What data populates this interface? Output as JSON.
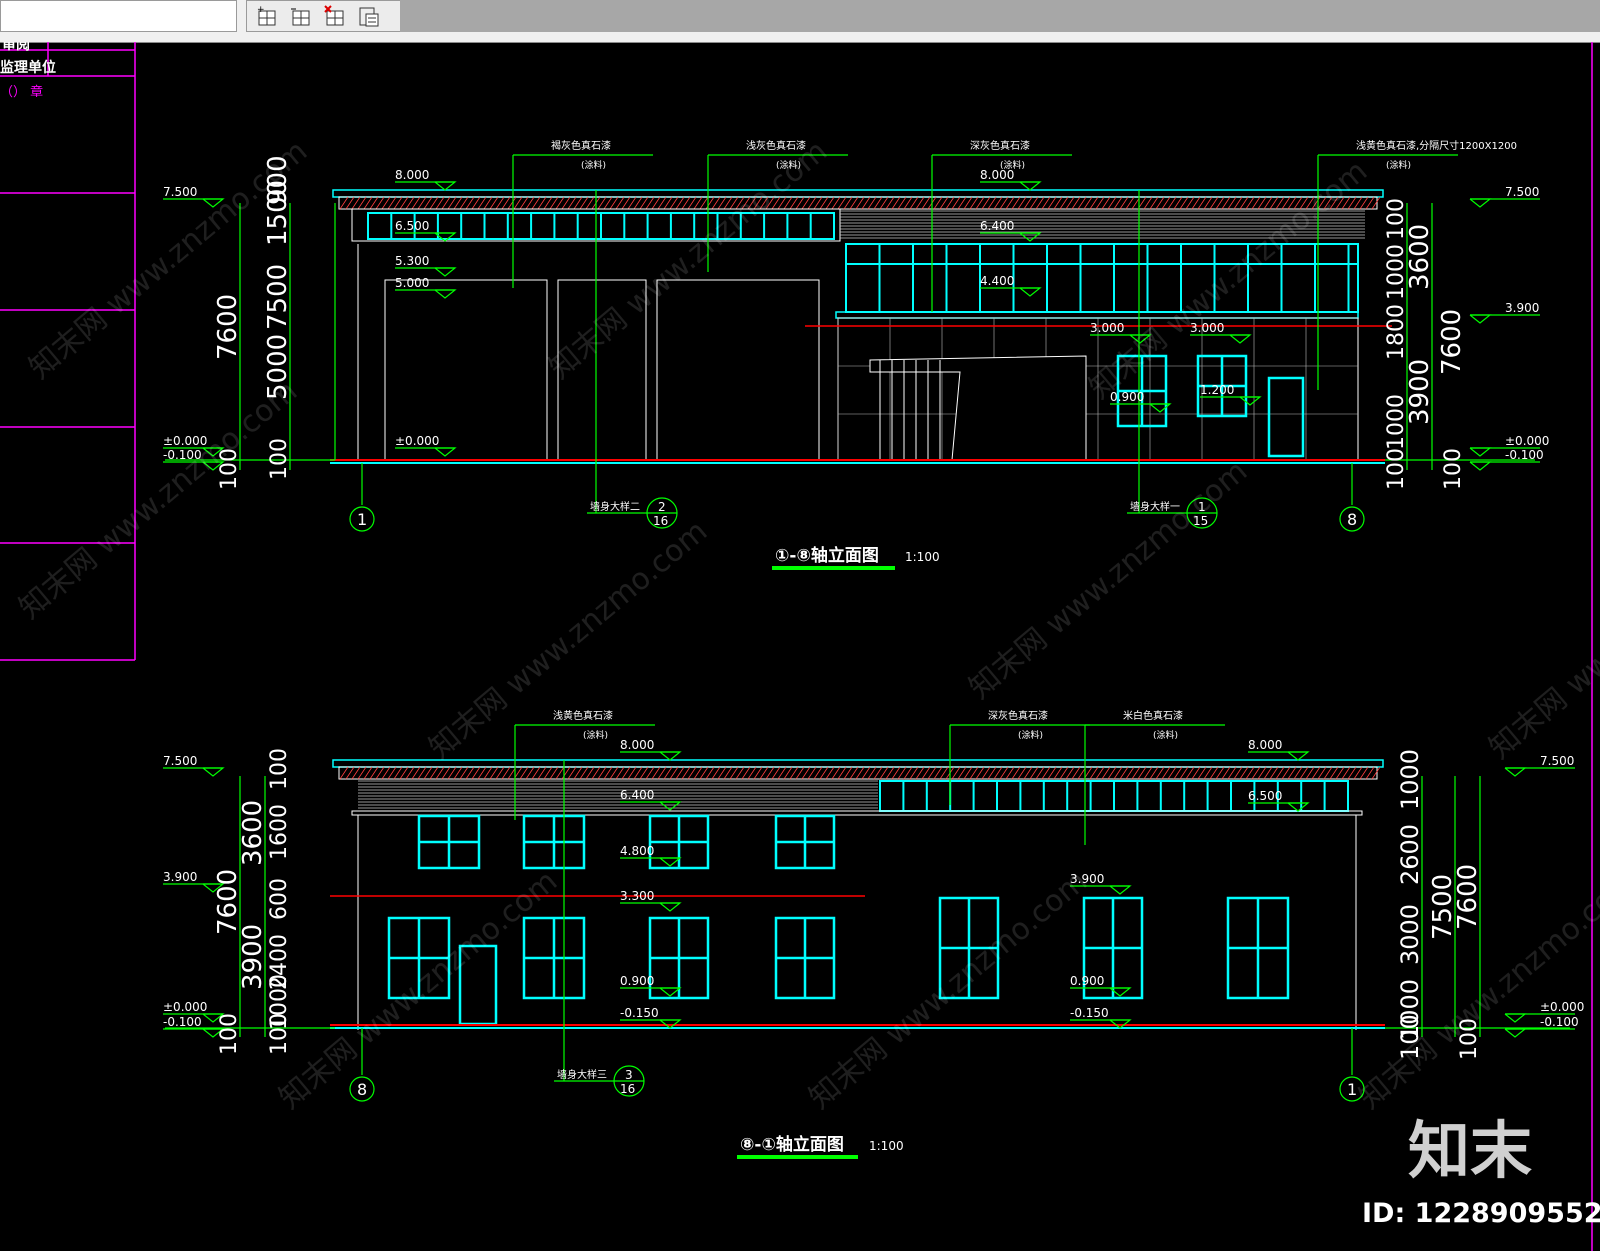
{
  "toolbar": {
    "buttons": [
      {
        "name": "insert-row-above-button",
        "icon": "insert-row-icon"
      },
      {
        "name": "insert-row-below-button",
        "icon": "insert-row-below-icon"
      },
      {
        "name": "delete-row-button",
        "icon": "delete-row-icon"
      },
      {
        "name": "paste-button",
        "icon": "paste-icon"
      }
    ]
  },
  "side_table": {
    "row1": "审阅",
    "row2": "监理单位",
    "row3": "（） 章"
  },
  "drawing1": {
    "title": "①-⑧轴立面图",
    "scale": "1:100",
    "callouts": [
      "褐灰色真石漆",
      "浅灰色真石漆",
      "深灰色真石漆",
      "浅黄色真石漆,分隔尺寸1200X1200"
    ],
    "callout_sub": "(涂料)",
    "levels_left": [
      "7.500",
      "±0.000",
      "-0.100"
    ],
    "levels_right": [
      "7.500",
      "3.900",
      "±0.000",
      "-0.100"
    ],
    "levels_inner": [
      "8.000",
      "6.500",
      "5.300",
      "5.000",
      "±0.000",
      "8.000",
      "6.400",
      "4.400",
      "3.000",
      "3.000",
      "0.900",
      "1.200"
    ],
    "dims_left_outer": [
      "7600",
      "100"
    ],
    "dims_left_inner": [
      "1500",
      "900",
      "7500",
      "5000",
      "100"
    ],
    "dims_right_outer": [
      "7600",
      "100"
    ],
    "dims_right_inner": [
      "100",
      "1000",
      "3600",
      "1800",
      "3900",
      "1000",
      "100"
    ],
    "axes": [
      "1",
      "8"
    ],
    "details": [
      {
        "label": "墙身大样二",
        "num": "2",
        "sheet": "16"
      },
      {
        "label": "墙身大样一",
        "num": "1",
        "sheet": "15"
      }
    ]
  },
  "drawing2": {
    "title": "⑧-①轴立面图",
    "scale": "1:100",
    "callouts": [
      "浅黄色真石漆",
      "深灰色真石漆",
      "米白色真石漆"
    ],
    "callout_sub": "(涂料)",
    "levels_left": [
      "7.500",
      "3.900",
      "±0.000",
      "-0.100"
    ],
    "levels_right": [
      "7.500",
      "±0.000",
      "-0.100"
    ],
    "levels_inner": [
      "8.000",
      "6.400",
      "4.800",
      "3.300",
      "0.900",
      "-0.150",
      "8.000",
      "6.500",
      "3.900",
      "0.900",
      "-0.150"
    ],
    "dims_left_outer": [
      "7600",
      "100"
    ],
    "dims_left_inner": [
      "100",
      "1600",
      "3600",
      "600",
      "3900",
      "2400",
      "1000",
      "100"
    ],
    "dims_right_outer": [
      "7600",
      "100"
    ],
    "dims_right_inner": [
      "1000",
      "2600",
      "7500",
      "3000",
      "1000",
      "100"
    ],
    "axes": [
      "8",
      "1"
    ],
    "details": [
      {
        "label": "墙身大样三",
        "num": "3",
        "sheet": "16"
      }
    ]
  },
  "watermark": {
    "site": "www.znzmo.com",
    "brand": "知末网",
    "logo": "知末",
    "id_text": "ID: 1228909552"
  },
  "colors": {
    "background": "#000000",
    "green": "#00ff00",
    "cyan": "#00ffff",
    "magenta": "#ff00ff",
    "red": "#ff0000",
    "white": "#ffffff"
  }
}
